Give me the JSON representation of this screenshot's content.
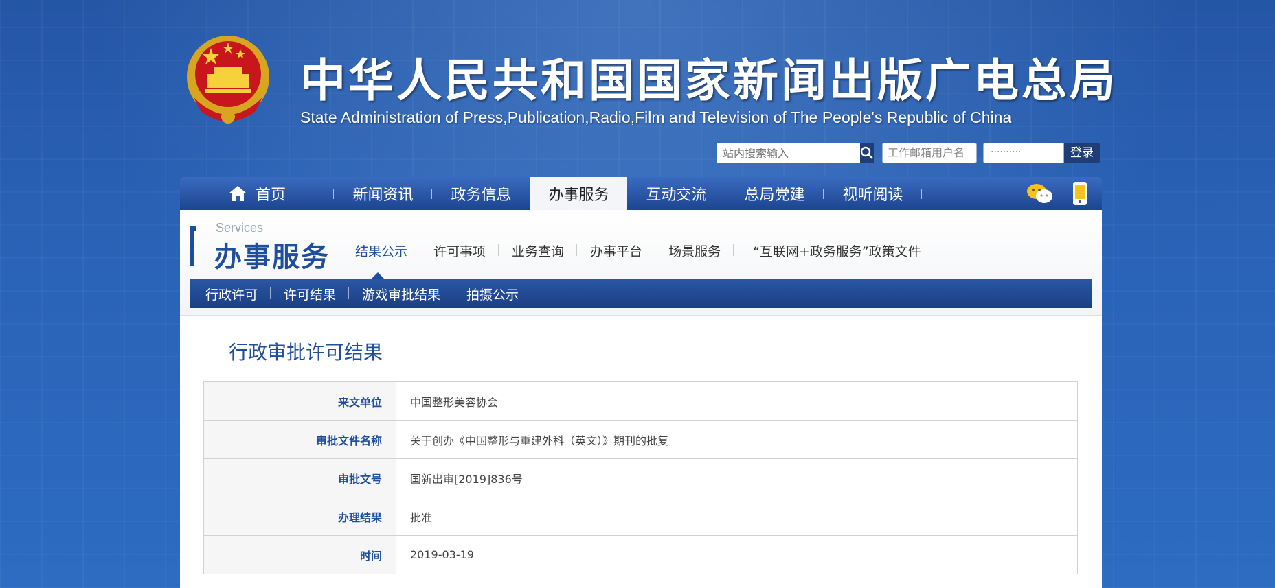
{
  "header": {
    "title_cn": "中华人民共和国国家新闻出版广电总局",
    "title_en": "State Administration of Press,Publication,Radio,Film and Television of The People's Republic of China",
    "search_placeholder": "站内搜索输入",
    "mail_placeholder": "工作邮箱用户名",
    "password_mask": "··········",
    "login_label": "登录"
  },
  "nav": {
    "items": [
      {
        "label": "首页"
      },
      {
        "label": "新闻资讯"
      },
      {
        "label": "政务信息"
      },
      {
        "label": "办事服务"
      },
      {
        "label": "互动交流"
      },
      {
        "label": "总局党建"
      },
      {
        "label": "视听阅读"
      }
    ]
  },
  "section": {
    "label_en": "Services",
    "label_cn": "办事服务",
    "tabs": [
      {
        "label": "结果公示"
      },
      {
        "label": "许可事项"
      },
      {
        "label": "业务查询"
      },
      {
        "label": "办事平台"
      },
      {
        "label": "场景服务"
      },
      {
        "label": "“互联网+政务服务”政策文件"
      }
    ],
    "sub_items": [
      {
        "label": "行政许可"
      },
      {
        "label": "许可结果"
      },
      {
        "label": "游戏审批结果"
      },
      {
        "label": "拍摄公示"
      }
    ]
  },
  "content": {
    "page_title": "行政审批许可结果",
    "rows": [
      {
        "label": "来文单位",
        "value": "中国整形美容协会"
      },
      {
        "label": "审批文件名称",
        "value": "关于创办《中国整形与重建外科（英文）》期刊的批复"
      },
      {
        "label": "审批文号",
        "value": "国新出审[2019]836号"
      },
      {
        "label": "办理结果",
        "value": "批准"
      },
      {
        "label": "时间",
        "value": "2019-03-19"
      }
    ]
  },
  "colors": {
    "brand_blue": "#1f4e9c",
    "nav_dark": "#1d4590",
    "page_bg": "#2a5aa8"
  },
  "icons": [
    "national-emblem-icon",
    "search-icon",
    "home-icon",
    "wechat-icon",
    "mobile-icon"
  ]
}
